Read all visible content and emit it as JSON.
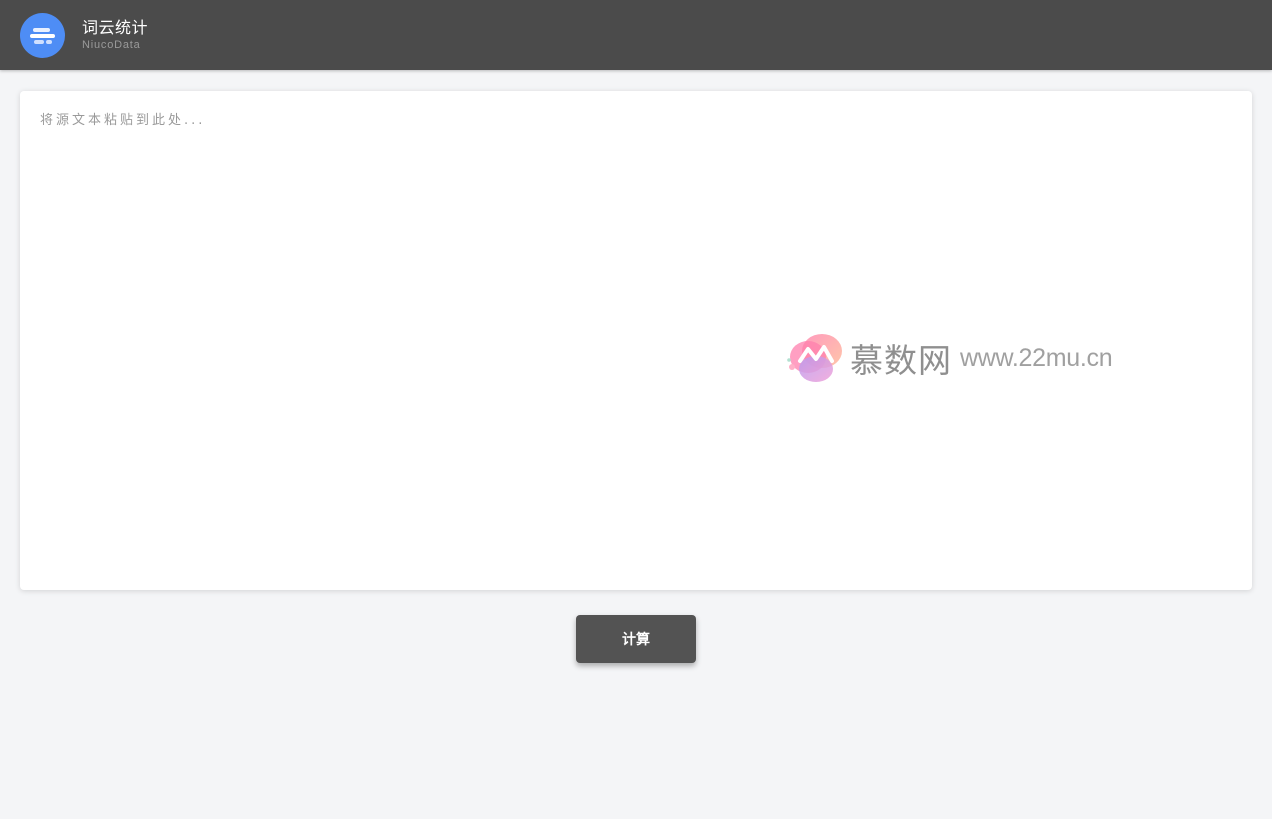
{
  "header": {
    "title": "词云统计",
    "subtitle": "NiucoData",
    "logo_icon": "bars-list-icon",
    "background": "#4b4b4b",
    "logo_color": "#4e8df5"
  },
  "editor": {
    "placeholder": "将源文本粘贴到此处...",
    "value": ""
  },
  "watermark": {
    "name": "慕数网",
    "url": "www.22mu.cn"
  },
  "actions": {
    "calculate_label": "计算"
  }
}
